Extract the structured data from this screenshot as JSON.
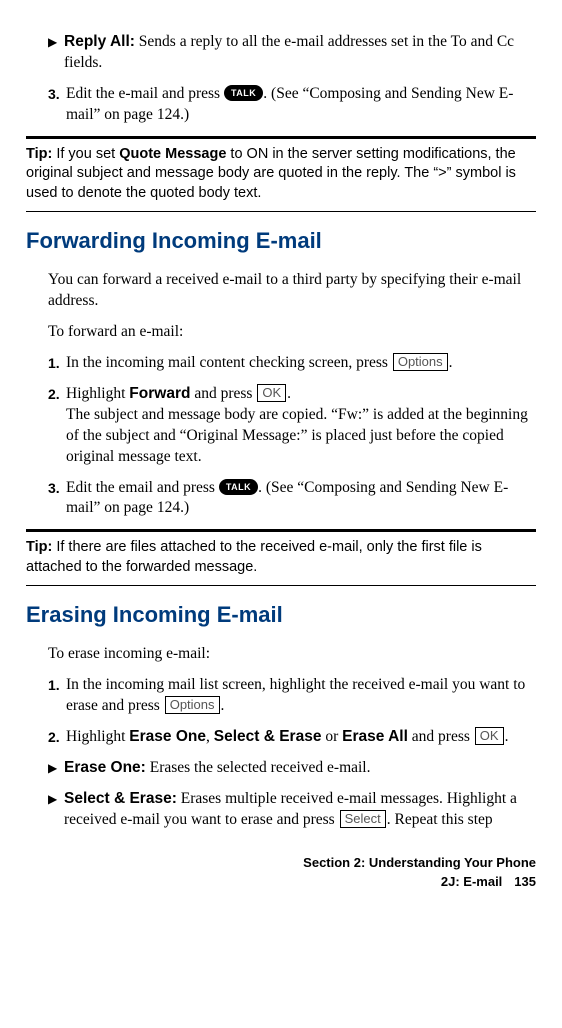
{
  "reply_all": {
    "label": "Reply All:",
    "desc": " Sends a reply to all the e-mail addresses set in the To and Cc fields."
  },
  "step3_a": {
    "num": "3.",
    "pre": "Edit the e-mail and press ",
    "key": "TALK",
    "post": ". (See “Composing and Sending New E-mail” on page 124.)"
  },
  "tip1": {
    "lead": "Tip:",
    "pre": " If you set ",
    "bold": "Quote Message",
    "post": " to ON in the server setting modifications, the original subject and message body are quoted in the reply. The “>” symbol is used to denote the quoted body text."
  },
  "heading_forward": "Forwarding Incoming E-mail",
  "forward_intro": "You can forward a received e-mail to a third party by specifying their e-mail address.",
  "forward_lead": "To forward an e-mail:",
  "fwd_step1": {
    "num": "1.",
    "pre": "In the incoming mail content checking screen, press ",
    "key": "Options",
    "post": "."
  },
  "fwd_step2": {
    "num": "2.",
    "pre1": "Highlight ",
    "bold1": "Forward",
    "pre2": " and press ",
    "key": "OK",
    "post1": ".",
    "line2": "The subject and message body are copied. “Fw:” is added at the beginning of the subject and “Original Message:” is placed just before the copied original message text."
  },
  "fwd_step3": {
    "num": "3.",
    "pre": "Edit the email and press ",
    "key": "TALK",
    "post": ". (See “Composing and Sending New E-mail” on page 124.)"
  },
  "tip2": {
    "lead": "Tip:",
    "body": " If there are files attached to the received e-mail, only the first file is attached to the forwarded message."
  },
  "heading_erase": "Erasing Incoming E-mail",
  "erase_lead": "To erase incoming e-mail:",
  "erase_step1": {
    "num": "1.",
    "pre": "In the incoming mail list screen, highlight the received e-mail you want to erase and press ",
    "key": "Options",
    "post": "."
  },
  "erase_step2": {
    "num": "2.",
    "pre1": "Highlight ",
    "b1": "Erase One",
    "c1": ", ",
    "b2": "Select & Erase",
    "c2": " or ",
    "b3": "Erase All",
    "c3": " and press ",
    "key": "OK",
    "post": "."
  },
  "erase_one": {
    "label": "Erase One:",
    "desc": " Erases the selected received e-mail."
  },
  "select_erase": {
    "label": "Select & Erase:",
    "pre": " Erases multiple received e-mail messages. Highlight a received e-mail you want to erase and press ",
    "key": "Select",
    "post": ". Repeat this step"
  },
  "footer": {
    "line1": "Section 2: Understanding Your Phone",
    "line2": "2J: E-mail",
    "page": "135"
  }
}
